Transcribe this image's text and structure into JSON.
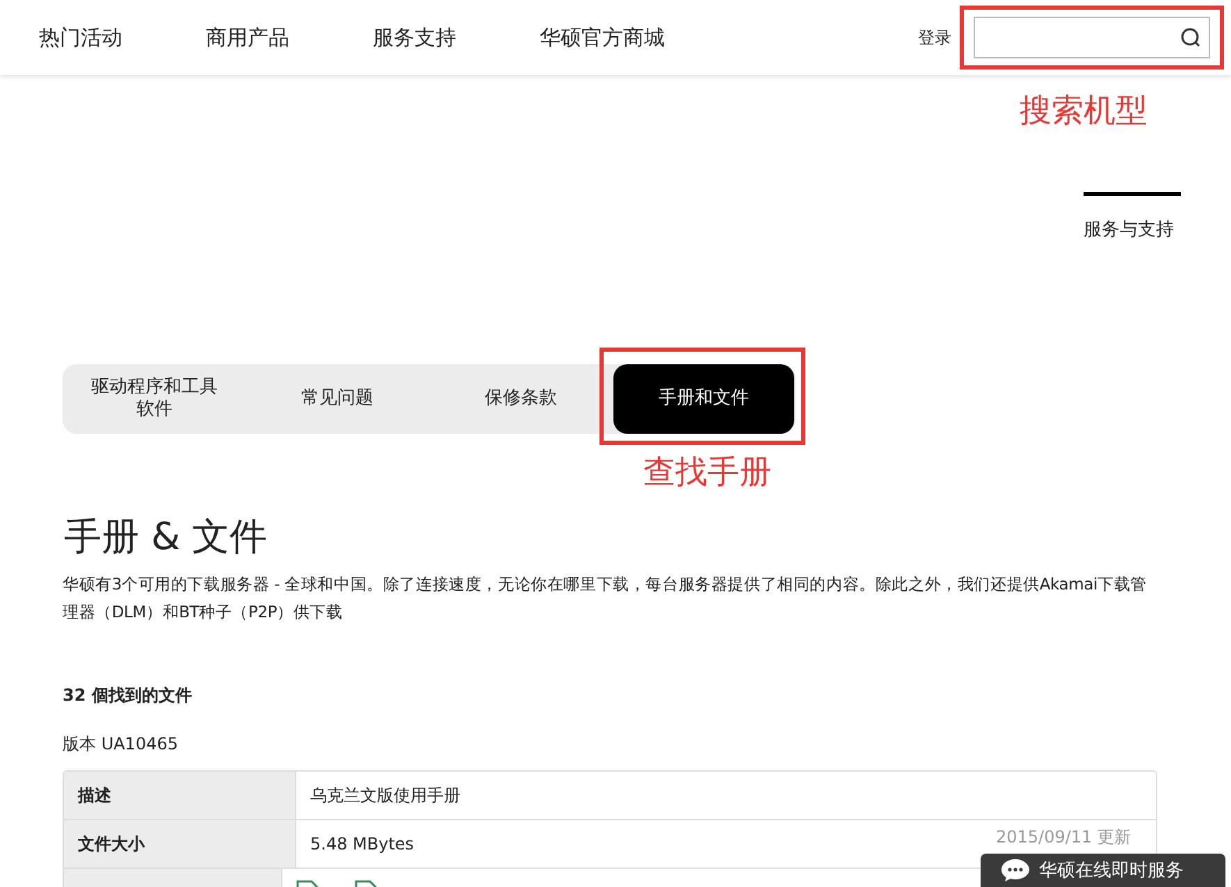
{
  "nav": {
    "items": [
      "热门活动",
      "商用产品",
      "服务支持",
      "华硕官方商城"
    ],
    "login": "登录"
  },
  "search": {
    "highlighted": true,
    "note": "搜索机型"
  },
  "section_link": "服务与支持",
  "tabs": [
    {
      "label": "驱动程序和工具软件",
      "selected": false,
      "highlighted": false
    },
    {
      "label": "常见问题",
      "selected": false,
      "highlighted": false
    },
    {
      "label": "保修条款",
      "selected": false,
      "highlighted": false
    },
    {
      "label": "手册和文件",
      "selected": true,
      "highlighted": true
    }
  ],
  "tab_note": "查找手册",
  "heading": "手册 & 文件",
  "intro": "华硕有3个可用的下载服务器 - 全球和中国。除了连接速度，无论你在哪里下载，每台服务器提供了相同的内容。除此之外，我们还提供Akamai下载管理器（DLM）和BT种子（P2P）供下载",
  "count": "32 個找到的文件",
  "version": "版本 UA10465",
  "table": {
    "rows": [
      {
        "label": "描述",
        "value": "乌克兰文版使用手册"
      },
      {
        "label": "文件大小",
        "value": "5.48 MBytes",
        "date": "2015/09/11 更新"
      },
      {
        "kind": "icons"
      }
    ]
  },
  "chat": {
    "label": "华硕在线即时服务"
  }
}
